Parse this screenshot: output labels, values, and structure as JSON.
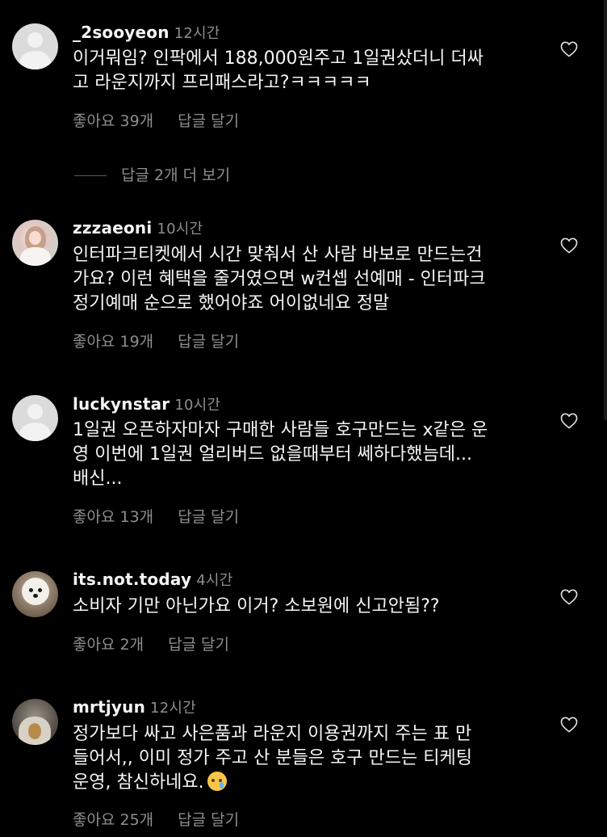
{
  "comments": [
    {
      "username": "_2sooyeon",
      "time": "12시간",
      "text": "이거뭐임? 인팍에서 188,000원주고 1일권샀더니 더싸\n고 라운지까지 프리패스라고?ㅋㅋㅋㅋㅋ",
      "likes": "좋아요 39개",
      "reply": "답글 달기",
      "avatar": "default"
    },
    {
      "username": "zzzaeoni",
      "time": "10시간",
      "text": "인터파크티켓에서 시간 맞춰서 산 사람 바보로 만드는건\n가요? 이런 혜택을 줄거였으면 w컨셉 선예매 - 인터파크\n정기예매 순으로 했어야죠 어이없네요 정말",
      "likes": "좋아요 19개",
      "reply": "답글 달기",
      "avatar": "photo"
    },
    {
      "username": "luckynstar",
      "time": "10시간",
      "text": "1일권 오픈하자마자 구매한 사람들 호구만드는 x같은 운\n영 이번에 1일권 얼리버드 없을때부터 쎄하다했늠데...\n배신...",
      "likes": "좋아요 13개",
      "reply": "답글 달기",
      "avatar": "default"
    },
    {
      "username": "its.not.today",
      "time": "4시간",
      "text": "소비자 기만 아닌가요 이거? 소보원에 신고안됨??",
      "likes": "좋아요 2개",
      "reply": "답글 달기",
      "avatar": "photo"
    },
    {
      "username": "mrtjyun",
      "time": "12시간",
      "text": "정가보다 싸고 사은품과 라운지 이용권까지 주는 표 만\n들어서,, 이미 정가 주고 산 분들은 호구 만드는 티케팅\n운영, 참신하네요.",
      "emoji": "crying-face",
      "likes": "좋아요 25개",
      "reply": "답글 달기",
      "avatar": "photo"
    }
  ],
  "view_replies": "답글 2개 더 보기",
  "icons": {
    "like": "heart-outline-icon",
    "default_avatar": "default-avatar-icon"
  },
  "colors": {
    "background": "#000000",
    "text": "#f5f5f5",
    "secondary": "#8e8e8e"
  }
}
